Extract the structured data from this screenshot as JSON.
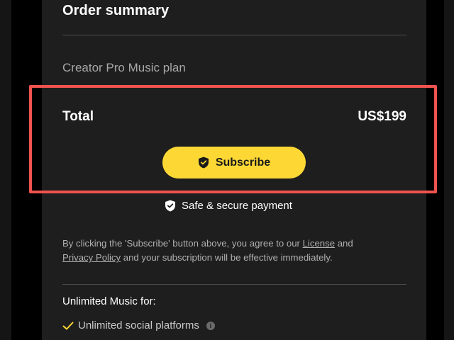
{
  "summary": {
    "title": "Order summary",
    "plan_name": "Creator Pro Music plan",
    "total_label": "Total",
    "total_amount": "US$199",
    "subscribe_label": "Subscribe",
    "secure_text": "Safe & secure payment"
  },
  "terms": {
    "prefix": "By clicking the 'Subscribe' button above, you agree to our ",
    "license_link": "License",
    "and_text": " and ",
    "privacy_link": "Privacy Policy",
    "suffix": " and your subscription will be effective immediately."
  },
  "features": {
    "title": "Unlimited Music for:",
    "items": [
      {
        "label": "Unlimited social platforms",
        "icon": "check-icon",
        "info_icon": "info-icon"
      }
    ]
  },
  "colors": {
    "background": "#000000",
    "panel": "#1e1e1e",
    "accent": "#fdd835",
    "highlight": "#ef5350",
    "check": "#fdd835"
  },
  "icons": {
    "subscribe": "shield-check-icon",
    "secure": "shield-check-icon"
  }
}
